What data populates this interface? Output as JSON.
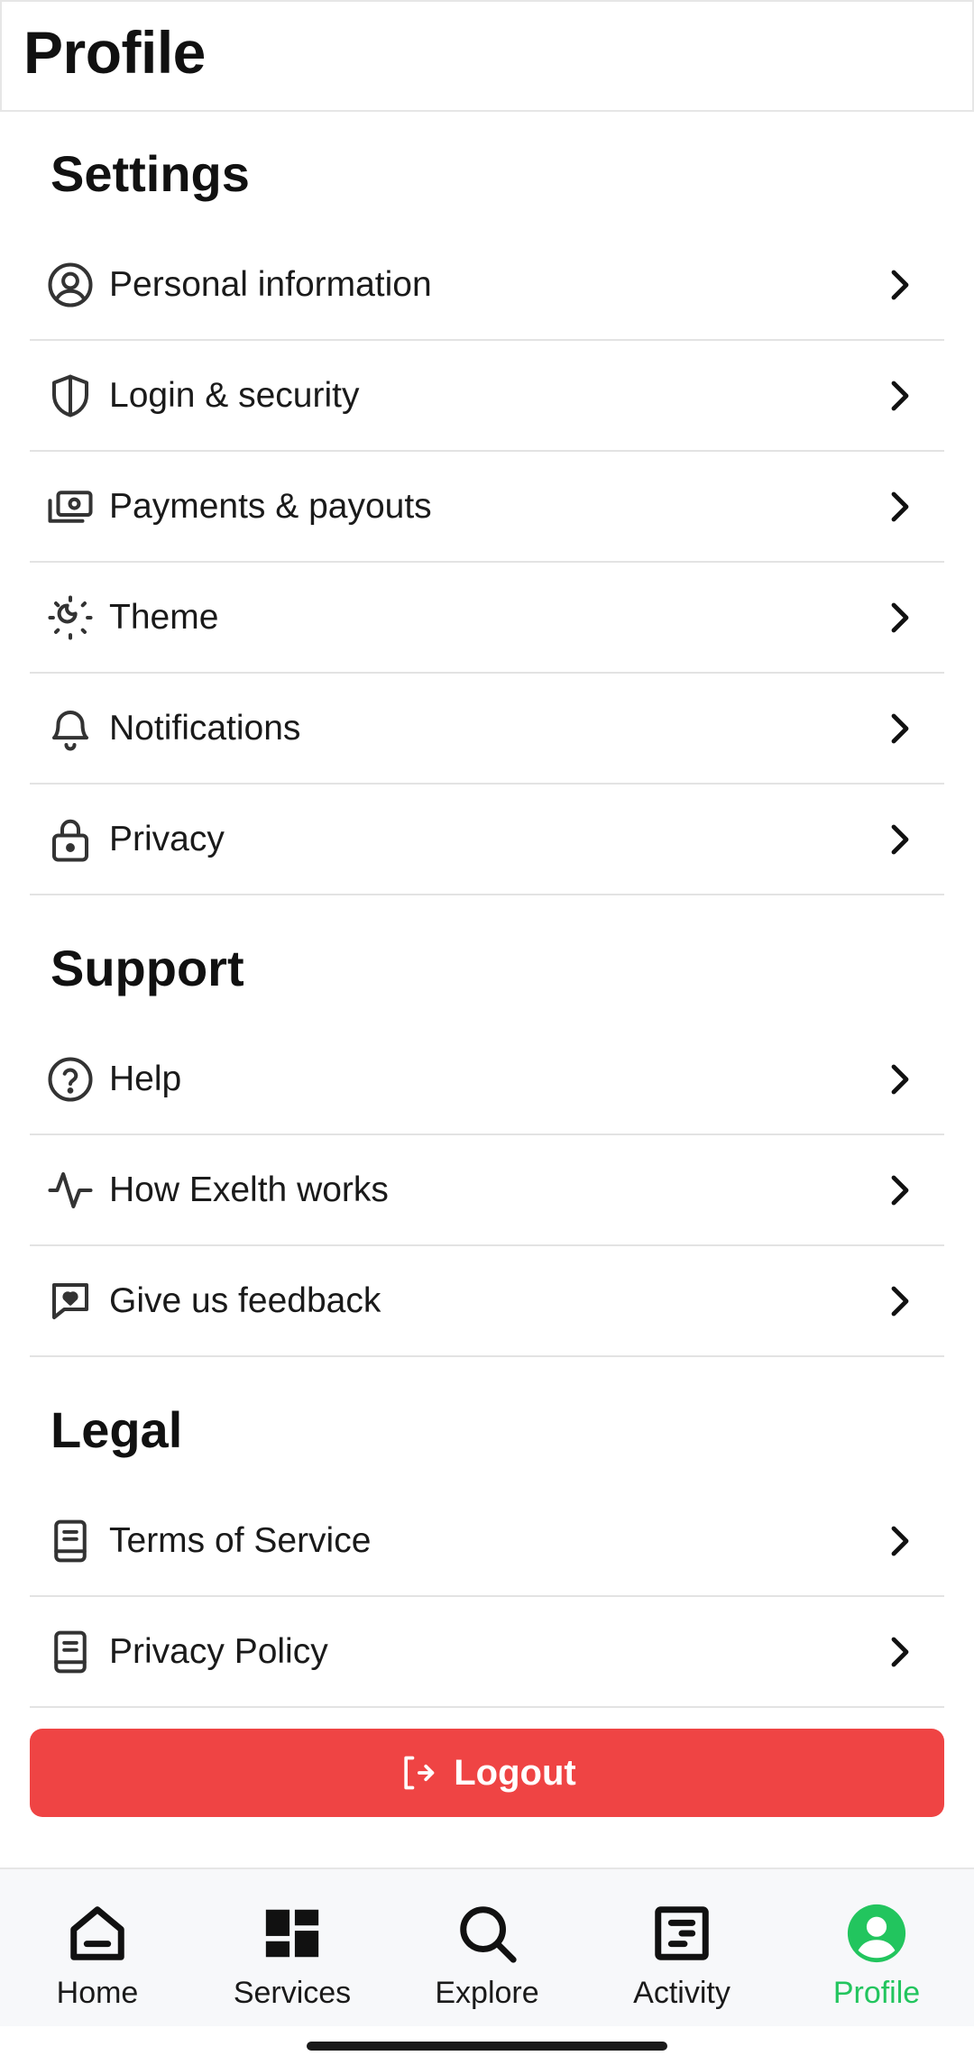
{
  "header": {
    "title": "Profile"
  },
  "sections": [
    {
      "title": "Settings",
      "items": [
        {
          "label": "Personal information",
          "icon": "user-circle-icon"
        },
        {
          "label": "Login & security",
          "icon": "shield-icon"
        },
        {
          "label": "Payments & payouts",
          "icon": "cash-icon"
        },
        {
          "label": "Theme",
          "icon": "sun-moon-icon"
        },
        {
          "label": "Notifications",
          "icon": "bell-icon"
        },
        {
          "label": "Privacy",
          "icon": "lock-icon"
        }
      ]
    },
    {
      "title": "Support",
      "items": [
        {
          "label": "Help",
          "icon": "help-circle-icon"
        },
        {
          "label": "How Exelth works",
          "icon": "activity-icon"
        },
        {
          "label": "Give us feedback",
          "icon": "message-heart-icon"
        }
      ]
    },
    {
      "title": "Legal",
      "items": [
        {
          "label": "Terms of Service",
          "icon": "book-icon"
        },
        {
          "label": "Privacy Policy",
          "icon": "book-icon"
        }
      ]
    }
  ],
  "logout": {
    "label": "Logout",
    "color": "#ef4444"
  },
  "tabbar": {
    "active_color": "#22c55e",
    "tabs": [
      {
        "label": "Home",
        "icon": "home-icon"
      },
      {
        "label": "Services",
        "icon": "dashboard-icon"
      },
      {
        "label": "Explore",
        "icon": "search-icon"
      },
      {
        "label": "Activity",
        "icon": "activity-list-icon"
      },
      {
        "label": "Profile",
        "icon": "user-circle-filled-icon",
        "active": true
      }
    ]
  }
}
